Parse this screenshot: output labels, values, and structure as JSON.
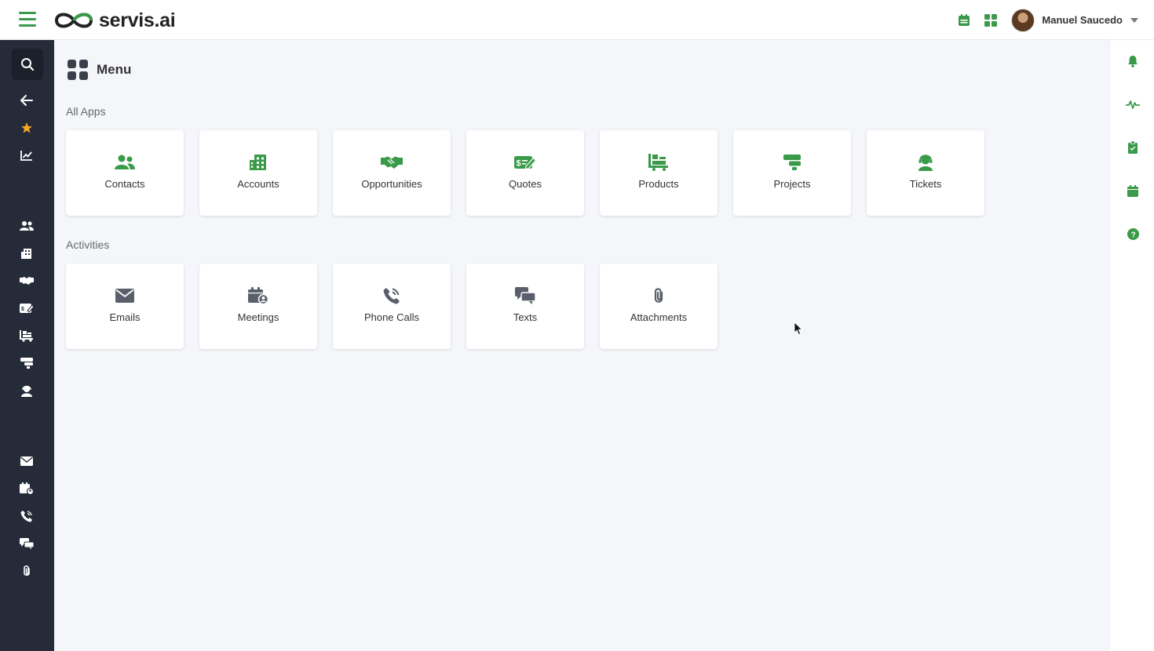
{
  "app": {
    "brand": "servis.ai",
    "accent_color": "#3a9a4a",
    "sidebar_color": "#252b38"
  },
  "header": {
    "user_name": "Manuel Saucedo",
    "icons": [
      "calendar-icon",
      "apps-grid-icon"
    ]
  },
  "sidebar": {
    "icons": [
      "search-icon",
      "back-arrow-icon",
      "star-icon",
      "chart-line-icon",
      "contacts-icon",
      "accounts-icon",
      "opportunities-icon",
      "quotes-icon",
      "products-icon",
      "projects-icon",
      "tickets-icon",
      "emails-icon",
      "meetings-icon",
      "phone-calls-icon",
      "texts-icon",
      "attachments-icon"
    ]
  },
  "rightbar": {
    "icons": [
      "bell-icon",
      "activity-pulse-icon",
      "clipboard-icon",
      "calendar-icon",
      "help-icon"
    ]
  },
  "page": {
    "title": "Menu"
  },
  "sections": {
    "all_apps": {
      "label": "All Apps",
      "items": [
        {
          "label": "Contacts",
          "icon": "contacts-icon"
        },
        {
          "label": "Accounts",
          "icon": "accounts-icon"
        },
        {
          "label": "Opportunities",
          "icon": "opportunities-icon"
        },
        {
          "label": "Quotes",
          "icon": "quotes-icon"
        },
        {
          "label": "Products",
          "icon": "products-icon"
        },
        {
          "label": "Projects",
          "icon": "projects-icon"
        },
        {
          "label": "Tickets",
          "icon": "tickets-icon"
        }
      ]
    },
    "activities": {
      "label": "Activities",
      "items": [
        {
          "label": "Emails",
          "icon": "emails-icon"
        },
        {
          "label": "Meetings",
          "icon": "meetings-icon"
        },
        {
          "label": "Phone Calls",
          "icon": "phone-calls-icon"
        },
        {
          "label": "Texts",
          "icon": "texts-icon"
        },
        {
          "label": "Attachments",
          "icon": "attachments-icon"
        }
      ]
    }
  }
}
